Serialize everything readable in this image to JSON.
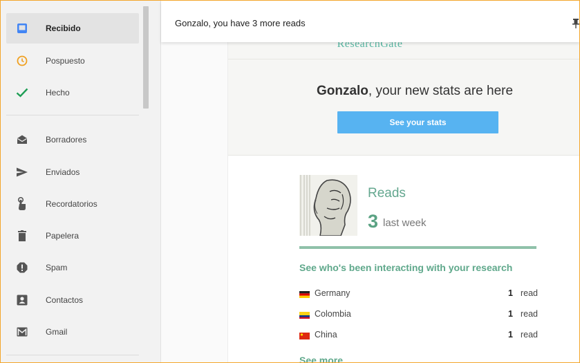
{
  "sidebar": {
    "items": [
      {
        "label": "Recibido",
        "icon": "inbox-icon",
        "active": true
      },
      {
        "label": "Pospuesto",
        "icon": "clock-icon"
      },
      {
        "label": "Hecho",
        "icon": "check-icon"
      },
      {
        "label": "Borradores",
        "icon": "drafts-icon"
      },
      {
        "label": "Enviados",
        "icon": "send-icon"
      },
      {
        "label": "Recordatorios",
        "icon": "reminder-icon"
      },
      {
        "label": "Papelera",
        "icon": "trash-icon"
      },
      {
        "label": "Spam",
        "icon": "spam-icon"
      },
      {
        "label": "Contactos",
        "icon": "contacts-icon"
      },
      {
        "label": "Gmail",
        "icon": "gmail-icon"
      }
    ]
  },
  "email": {
    "subject": "Gonzalo, you have 3 more reads",
    "brand": "ResearchGate",
    "headline_name": "Gonzalo",
    "headline_rest": ", your new stats are here",
    "stats_button": "See your stats",
    "reads_title": "Reads",
    "reads_count": "3",
    "reads_period": "last week",
    "interact_heading": "See who's been interacting with your research",
    "countries": [
      {
        "name": "Germany",
        "count": "1",
        "unit": "read"
      },
      {
        "name": "Colombia",
        "count": "1",
        "unit": "read"
      },
      {
        "name": "China",
        "count": "1",
        "unit": "read"
      }
    ],
    "see_more": "See more"
  },
  "colors": {
    "accent_green": "#5fa88b",
    "button_blue": "#57b3f1",
    "frame_orange": "#f4a62a",
    "check_green": "#1e9e55",
    "clock_orange": "#f0a020"
  }
}
